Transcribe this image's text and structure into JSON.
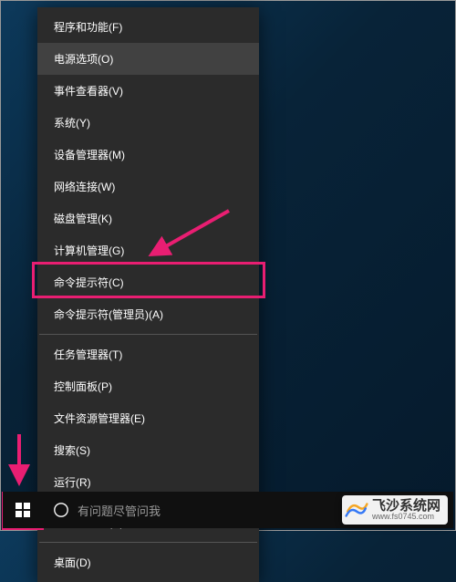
{
  "menu": {
    "items": [
      {
        "label": "程序和功能(F)"
      },
      {
        "label": "电源选项(O)",
        "hover": true
      },
      {
        "label": "事件查看器(V)"
      },
      {
        "label": "系统(Y)"
      },
      {
        "label": "设备管理器(M)"
      },
      {
        "label": "网络连接(W)"
      },
      {
        "label": "磁盘管理(K)"
      },
      {
        "label": "计算机管理(G)"
      },
      {
        "label": "命令提示符(C)"
      },
      {
        "label": "命令提示符(管理员)(A)",
        "highlighted": true
      },
      {
        "sep": true
      },
      {
        "label": "任务管理器(T)"
      },
      {
        "label": "控制面板(P)"
      },
      {
        "label": "文件资源管理器(E)"
      },
      {
        "label": "搜索(S)"
      },
      {
        "label": "运行(R)"
      },
      {
        "sep": true
      },
      {
        "label": "关机或注销(U)",
        "submenu": true
      },
      {
        "sep": true
      },
      {
        "label": "桌面(D)"
      }
    ]
  },
  "taskbar": {
    "cortana_placeholder": "有问题尽管问我"
  },
  "watermark": {
    "text": "飞沙系统网",
    "url": "www.fs0745.com"
  }
}
